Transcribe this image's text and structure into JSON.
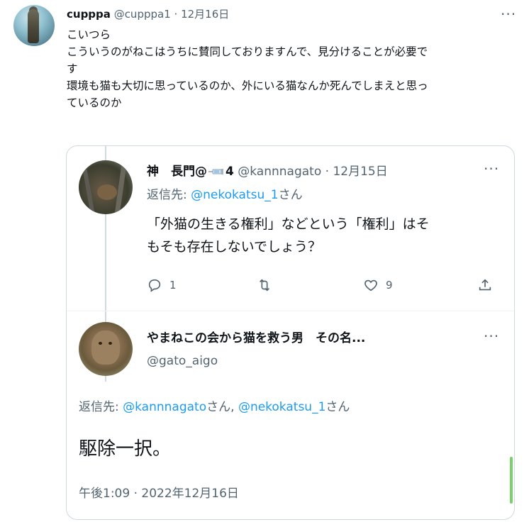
{
  "tweet": {
    "name": "cupppa",
    "handle": "@cupppa1",
    "separator": " · ",
    "date": "12月16日",
    "lines": [
      "こいつら",
      "",
      "こういうのがねこはうちに賛同しておりますんで、見分けることが必要で",
      "す",
      "環境も猫も大切に思っているのか、外にいる猫なんか死んでしまえと思っ",
      "ているのか"
    ],
    "more": "···"
  },
  "quoted": {
    "name_part1": "神　長門@",
    "name_part2": "4",
    "handle": "@kannnagato",
    "separator": " · ",
    "date": "12月15日",
    "reply_prefix": "返信先: ",
    "reply_handle": "@nekokatsu_1",
    "reply_suffix": "さん",
    "text_line1": "「外猫の生きる権利」などという「権利」はそ",
    "text_line2": "もそも存在しないでしょう？",
    "reply_count": "1",
    "like_count": "9",
    "more": "···"
  },
  "reply": {
    "name": "やまねこの会から猫を救う男　その名...",
    "handle": "@gato_aigo",
    "reply_prefix": "返信先: ",
    "reply_handle1": "@kannnagato",
    "reply_mid": "さん, ",
    "reply_handle2": "@nekokatsu_1",
    "reply_suffix": "さん",
    "text": "駆除一択。",
    "timestamp": "午後1:09 · 2022年12月16日",
    "more": "···"
  },
  "icons": {
    "reply": "reply-icon",
    "retweet": "retweet-icon",
    "like": "heart-icon",
    "share": "share-icon",
    "syringe": "syringe-emoji-icon"
  },
  "colors": {
    "link": "#1d9bf0",
    "secondary": "#536471",
    "text": "#0f1419",
    "border": "#cfd9de"
  }
}
